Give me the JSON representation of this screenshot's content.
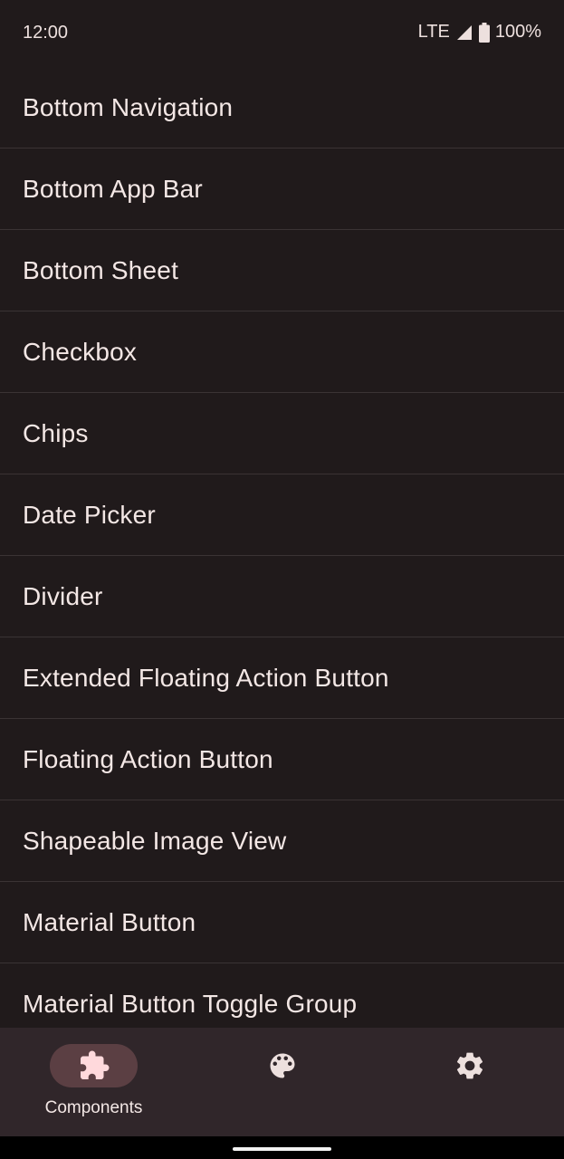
{
  "status_bar": {
    "time": "12:00",
    "network": "LTE",
    "battery": "100%",
    "icons": [
      "signal-icon",
      "battery-icon"
    ]
  },
  "list": {
    "items": [
      {
        "label": "Bottom Navigation"
      },
      {
        "label": "Bottom App Bar"
      },
      {
        "label": "Bottom Sheet"
      },
      {
        "label": "Checkbox"
      },
      {
        "label": "Chips"
      },
      {
        "label": "Date Picker"
      },
      {
        "label": "Divider"
      },
      {
        "label": "Extended Floating Action Button"
      },
      {
        "label": "Floating Action Button"
      },
      {
        "label": "Shapeable Image View"
      },
      {
        "label": "Material Button"
      },
      {
        "label": "Material Button Toggle Group"
      }
    ]
  },
  "bottom_nav": {
    "items": [
      {
        "label": "Components",
        "icon": "puzzle-icon",
        "selected": true
      },
      {
        "label": "",
        "icon": "palette-icon",
        "selected": false
      },
      {
        "label": "",
        "icon": "gear-icon",
        "selected": false
      }
    ]
  },
  "colors": {
    "background": "#201a1b",
    "nav_background": "#30262a",
    "nav_pill": "#5b3f43",
    "selected_icon": "#ffd9dc",
    "icon": "#ede0de",
    "divider": "#3a3334"
  }
}
